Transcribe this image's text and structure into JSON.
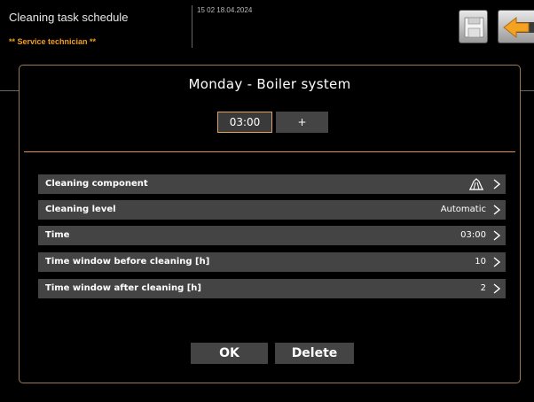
{
  "header": {
    "title": "Cleaning task schedule",
    "user_role": "** Service technician **",
    "datetime": "15 02 18.04.2024"
  },
  "toolbar": {
    "save_icon": "floppy-disk-icon",
    "back_icon": "back-arrow-icon"
  },
  "dialog": {
    "title": "Monday - Boiler system",
    "time_value": "03:00",
    "add_label": "+",
    "rows": [
      {
        "label": "Cleaning component",
        "value": "",
        "icon": "cleaning-component-icon"
      },
      {
        "label": "Cleaning level",
        "value": "Automatic"
      },
      {
        "label": "Time",
        "value": "03:00"
      },
      {
        "label": "Time window before cleaning [h]",
        "value": "10"
      },
      {
        "label": "Time window after cleaning [h]",
        "value": "2"
      }
    ],
    "ok_label": "OK",
    "delete_label": "Delete"
  },
  "colors": {
    "accent": "#e09050",
    "role": "#f0a020",
    "row_bg": "#444444"
  }
}
